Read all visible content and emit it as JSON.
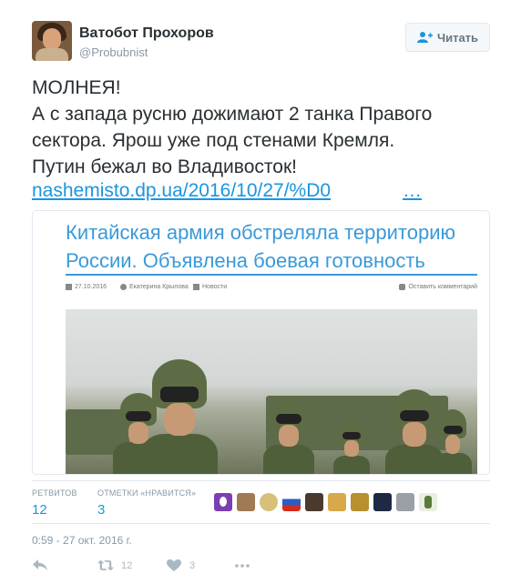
{
  "author": {
    "display_name": "Ватобот Прохоров",
    "screen_name": "@Probubnist"
  },
  "follow_button": {
    "label": "Читать",
    "icon": "add-user-icon"
  },
  "tweet": {
    "lines": [
      "МОЛНЕЯ!",
      "А с запада русню дожимают 2 танка Правого",
      "сектора. Ярош уже под стенами Кремля.",
      "Путин бежал во Владивосток!"
    ],
    "link_text": "nashemisto.dp.ua/2016/10/27/%D0",
    "link_ellipsis": "…"
  },
  "card": {
    "headline_line1": "Китайская армия обстреляла территорию",
    "headline_line2": "России. Объявлена боевая готовность",
    "meta_date": "27.10.2016",
    "meta_author": "Екатерина Крылова",
    "meta_category": "Новости",
    "meta_comment": "Оставить комментарий",
    "accent_color": "#3a9ad9"
  },
  "stats": {
    "retweets_label": "РЕТВИТОВ",
    "retweets_value": "12",
    "likes_label": "ОТМЕТКИ «НРАВИТСЯ»",
    "likes_value": "3",
    "likers_count_shown": 10
  },
  "timestamp": "0:59 - 27 окт. 2016 г.",
  "actions": {
    "reply_icon": "reply-icon",
    "retweet_icon": "retweet-icon",
    "retweet_count": "12",
    "like_icon": "heart-icon",
    "like_count": "3",
    "more_icon": "more-icon"
  },
  "colors": {
    "link": "#1b95e0",
    "muted": "#8899a6",
    "text": "#292f33"
  }
}
